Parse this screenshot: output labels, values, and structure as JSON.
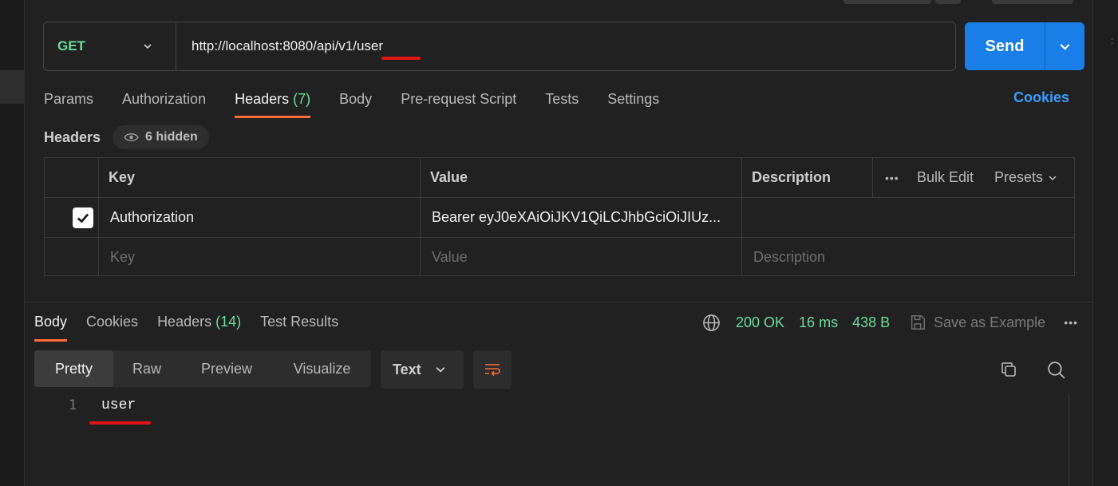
{
  "request": {
    "method": "GET",
    "url": "http://localhost:8080/api/v1/user",
    "send_label": "Send"
  },
  "request_tabs": [
    {
      "label": "Params"
    },
    {
      "label": "Authorization"
    },
    {
      "label": "Headers",
      "count": "(7)",
      "active": true
    },
    {
      "label": "Body"
    },
    {
      "label": "Pre-request Script"
    },
    {
      "label": "Tests"
    },
    {
      "label": "Settings"
    }
  ],
  "cookies_link": "Cookies",
  "headers_section": {
    "title": "Headers",
    "hidden_label": "6 hidden"
  },
  "headers_table": {
    "columns": [
      "Key",
      "Value",
      "Description"
    ],
    "more_label": "•••",
    "bulk_edit_label": "Bulk Edit",
    "presets_label": "Presets",
    "rows": [
      {
        "checked": true,
        "key": "Authorization",
        "value": "Bearer eyJ0eXAiOiJKV1QiLCJhbGciOiJIUz...",
        "description": ""
      }
    ],
    "placeholder": {
      "key": "Key",
      "value": "Value",
      "description": "Description"
    }
  },
  "response_tabs": [
    {
      "label": "Body",
      "active": true
    },
    {
      "label": "Cookies"
    },
    {
      "label": "Headers",
      "count": "(14)"
    },
    {
      "label": "Test Results"
    }
  ],
  "response_status": {
    "status": "200 OK",
    "time": "16 ms",
    "size": "438 B",
    "save_label": "Save as Example",
    "more_label": "•••"
  },
  "view_modes": [
    "Pretty",
    "Raw",
    "Preview",
    "Visualize"
  ],
  "active_view_mode": "Pretty",
  "body_type": "Text",
  "response_body": {
    "line_number": "1",
    "text": "user"
  },
  "colors": {
    "accent_orange": "#ff6c37",
    "send_blue": "#1a7ee8",
    "success_green": "#6bdd9a",
    "annotation_red": "#e01616"
  },
  "icons": [
    "chevron-down-icon",
    "eye-icon",
    "check-icon",
    "globe-icon",
    "save-icon",
    "wrap-lines-icon",
    "copy-icon",
    "search-icon"
  ]
}
